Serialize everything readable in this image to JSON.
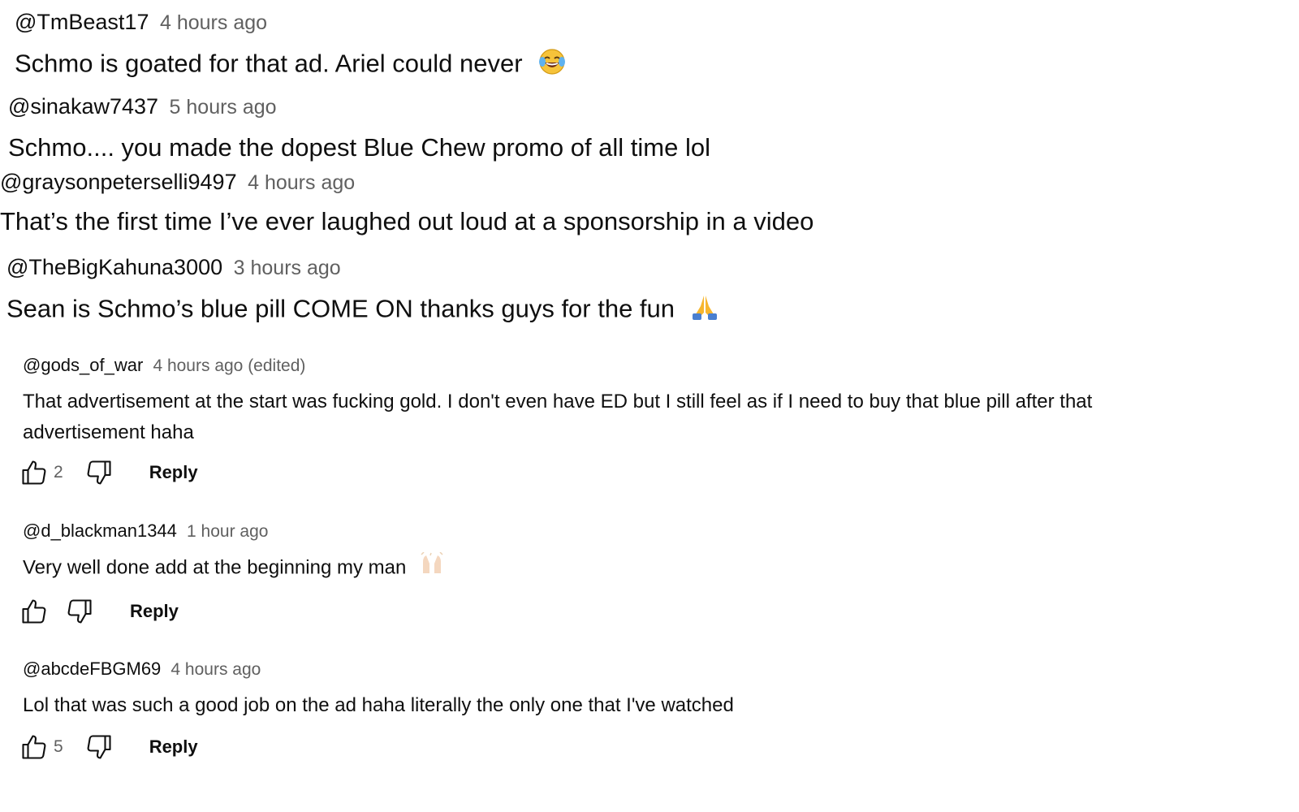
{
  "comments_top": [
    {
      "author": "@TmBeast17",
      "time": "4 hours ago",
      "text": "Schmo is goated for that ad. Ariel could never",
      "emoji": "laughing-tears-emoji-icon"
    },
    {
      "author": "@sinakaw7437",
      "time": "5 hours ago",
      "text": "Schmo.... you made the dopest Blue Chew promo of all time lol"
    },
    {
      "author": "@graysonpeterselli9497",
      "time": "4 hours ago",
      "text": "That’s the first time I’ve ever laughed out loud at a sponsorship in a video"
    },
    {
      "author": "@TheBigKahuna3000",
      "time": "3 hours ago",
      "text": "Sean is Schmo’s blue pill COME ON thanks guys for the fun",
      "emoji": "folded-hands-emoji-icon"
    }
  ],
  "comments_bottom": [
    {
      "author": "@gods_of_war",
      "time": "4 hours ago (edited)",
      "text": "That advertisement at the start was fucking gold. I don't even have ED but I still feel as if I need to buy that blue pill after that advertisement haha",
      "likes": "2",
      "reply_label": "Reply"
    },
    {
      "author": "@d_blackman1344",
      "time": "1 hour ago",
      "text": "Very well done add at the beginning my man",
      "emoji": "raising-hands-emoji-icon",
      "likes": "",
      "reply_label": "Reply"
    },
    {
      "author": "@abcdeFBGM69",
      "time": "4 hours ago",
      "text": "Lol that was such a good job on the ad haha literally the only one that I've watched",
      "likes": "5",
      "reply_label": "Reply"
    }
  ],
  "colors": {
    "text": "#0f0f0f",
    "secondary": "#606060",
    "background": "#ffffff"
  }
}
